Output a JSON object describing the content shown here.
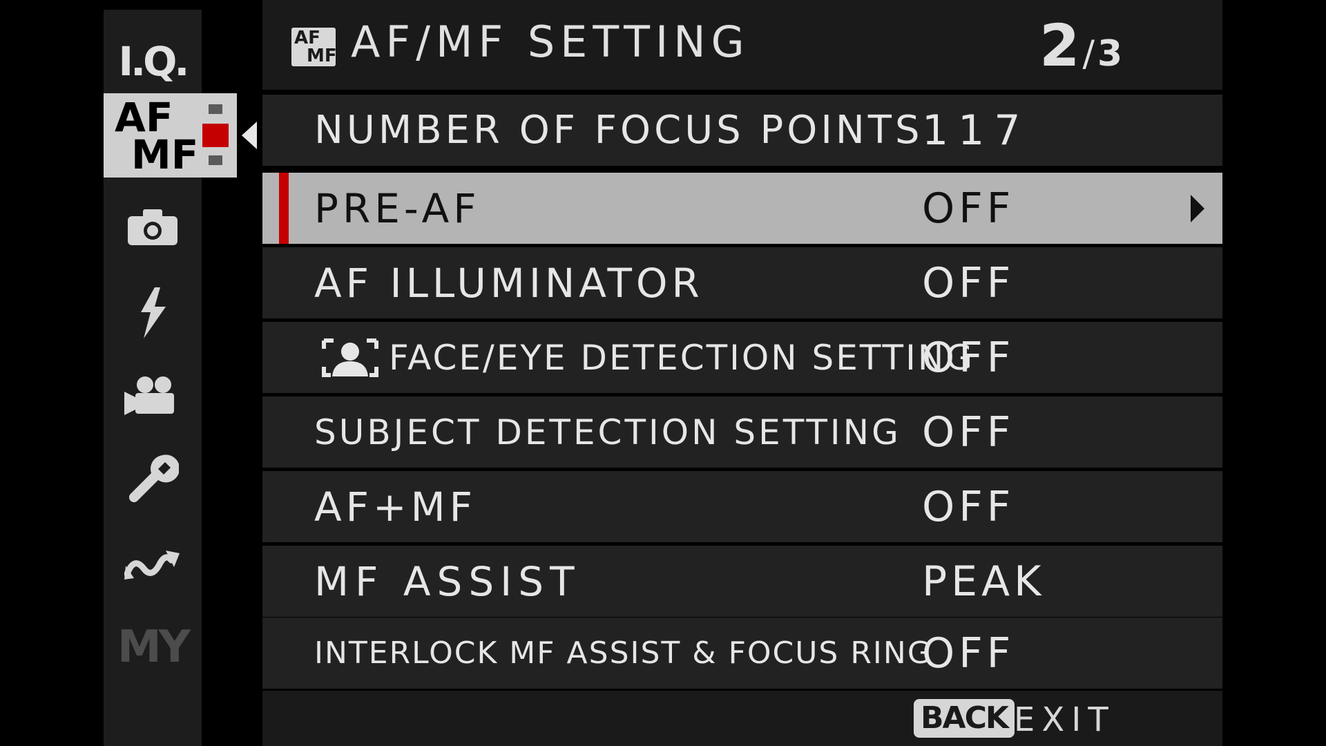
{
  "sidebar": {
    "items": [
      {
        "id": "iq",
        "label": "I.Q.",
        "icon": "image-quality-icon"
      },
      {
        "id": "afmf",
        "af": "AF",
        "mf": "MF",
        "icon": "af-mf-icon",
        "active": true
      },
      {
        "id": "shooting",
        "icon": "camera-icon"
      },
      {
        "id": "flash",
        "icon": "flash-icon"
      },
      {
        "id": "movie",
        "icon": "movie-camera-icon"
      },
      {
        "id": "setup",
        "icon": "wrench-icon"
      },
      {
        "id": "connection",
        "icon": "connection-icon"
      },
      {
        "id": "my",
        "label": "MY",
        "icon": "my-menu-icon"
      }
    ]
  },
  "header": {
    "icon_af": "AF",
    "icon_mf": "MF",
    "title": "AF/MF SETTING",
    "page_current": "2",
    "page_total": "3"
  },
  "rows": [
    {
      "label": "NUMBER OF FOCUS POINTS",
      "value": "117"
    },
    {
      "label": "PRE-AF",
      "value": "OFF",
      "selected": true
    },
    {
      "label": "AF ILLUMINATOR",
      "value": "OFF"
    },
    {
      "label": "FACE/EYE DETECTION SETTING",
      "value": "OFF",
      "icon": "face-detection-icon"
    },
    {
      "label": "SUBJECT DETECTION SETTING",
      "value": "OFF"
    },
    {
      "label": "AF+MF",
      "value": "OFF"
    },
    {
      "label": "MF ASSIST",
      "value": "PEAK"
    },
    {
      "label": "INTERLOCK MF ASSIST & FOCUS RING",
      "value": "OFF"
    }
  ],
  "footer": {
    "back_label": "BACK",
    "exit_label": "EXIT"
  },
  "colors": {
    "selection_accent": "#c40000",
    "selected_row_bg": "#b4b4b4",
    "row_bg": "#222222",
    "sidebar_bg": "#1d1d1d"
  }
}
